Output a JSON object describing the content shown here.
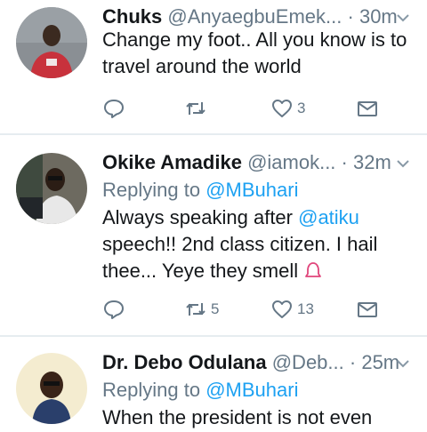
{
  "tweets": [
    {
      "name": "Chuks",
      "handle": "@AnyaegbuEmek...",
      "dot": "·",
      "time": "30m",
      "reply_label": "",
      "reply_handle": "",
      "text": "Change my foot.. All you know is to travel around the world",
      "retweets": "",
      "likes": "3"
    },
    {
      "name": "Okike Amadike",
      "handle": "@iamok...",
      "dot": "·",
      "time": "32m",
      "reply_label": "Replying to",
      "reply_handle": "@MBuhari",
      "text_parts": [
        "Always speaking after ",
        "@atiku",
        " speech!! 2nd class citizen. I hail thee...  Yeye they smell "
      ],
      "retweets": "5",
      "likes": "13"
    },
    {
      "name": "Dr. Debo Odulana",
      "handle": "@Deb...",
      "dot": "·",
      "time": "25m",
      "reply_label": "Replying to",
      "reply_handle": "@MBuhari",
      "text": "When the president is not even"
    }
  ],
  "colors": {
    "accent": "#1da1f2",
    "muted": "#657786",
    "divider": "#e6ecf0",
    "text": "#14171a"
  },
  "icons": [
    "reply-icon",
    "retweet-icon",
    "like-icon",
    "dm-icon",
    "chevron-down-icon",
    "bell-emoji-icon"
  ]
}
